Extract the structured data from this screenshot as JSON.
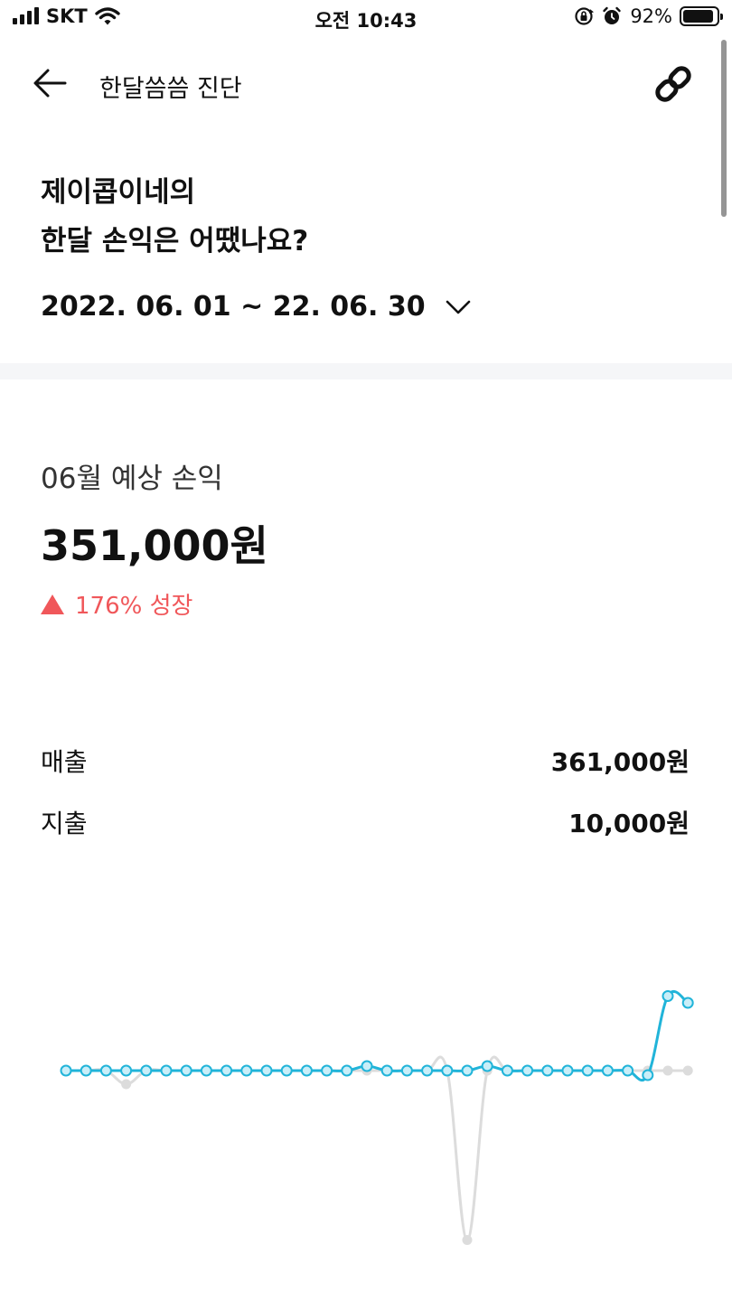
{
  "status_bar": {
    "carrier": "SKT",
    "time": "오전 10:43",
    "battery_percent": "92%",
    "battery_level": 0.92,
    "icons": [
      "signal-icon",
      "wifi-icon",
      "orientation-lock-icon",
      "alarm-icon",
      "battery-icon"
    ]
  },
  "header": {
    "title": "한달씀씀 진단",
    "back_icon": "arrow-left-icon",
    "share_icon": "link-icon"
  },
  "headline": {
    "line1": "제이콥이네의",
    "line2": "한달 손익은 어땠나요?"
  },
  "period": {
    "label": "2022. 06. 01 ~ 22. 06. 30",
    "icon": "chevron-down-icon"
  },
  "profit": {
    "label": "06월 예상 손익",
    "value": "351,000원",
    "growth_text": "176% 성장",
    "growth_color": "#f0575a"
  },
  "summary": {
    "sales_label": "매출",
    "sales_value": "361,000원",
    "expense_label": "지출",
    "expense_value": "10,000원"
  },
  "colors": {
    "accent": "#21b4d9",
    "secondary_line": "#dcdcdc",
    "growth_red": "#f0575a"
  },
  "chart_data": {
    "type": "line",
    "x": [
      1,
      2,
      3,
      4,
      5,
      6,
      7,
      8,
      9,
      10,
      11,
      12,
      13,
      14,
      15,
      16,
      17,
      18,
      19,
      20,
      21,
      22,
      23,
      24,
      25,
      26,
      27,
      28,
      29,
      30,
      31
    ],
    "series": [
      {
        "color": "#21b4d9",
        "values": [
          0,
          0,
          0,
          0,
          0,
          0,
          0,
          0,
          0,
          0,
          0,
          0,
          0,
          0,
          0,
          2,
          0,
          0,
          0,
          0,
          0,
          2,
          0,
          0,
          0,
          0,
          0,
          0,
          0,
          -2,
          33,
          30
        ]
      },
      {
        "color": "#dcdcdc",
        "values": [
          0,
          0,
          0,
          -6,
          0,
          0,
          0,
          0,
          0,
          0,
          0,
          0,
          0,
          0,
          0,
          0,
          0,
          0,
          0,
          0,
          -75,
          0,
          0,
          0,
          0,
          0,
          0,
          0,
          0,
          0,
          0,
          0
        ]
      }
    ],
    "ylim": [
      -80,
      40
    ],
    "grid": false,
    "legend": "none"
  }
}
